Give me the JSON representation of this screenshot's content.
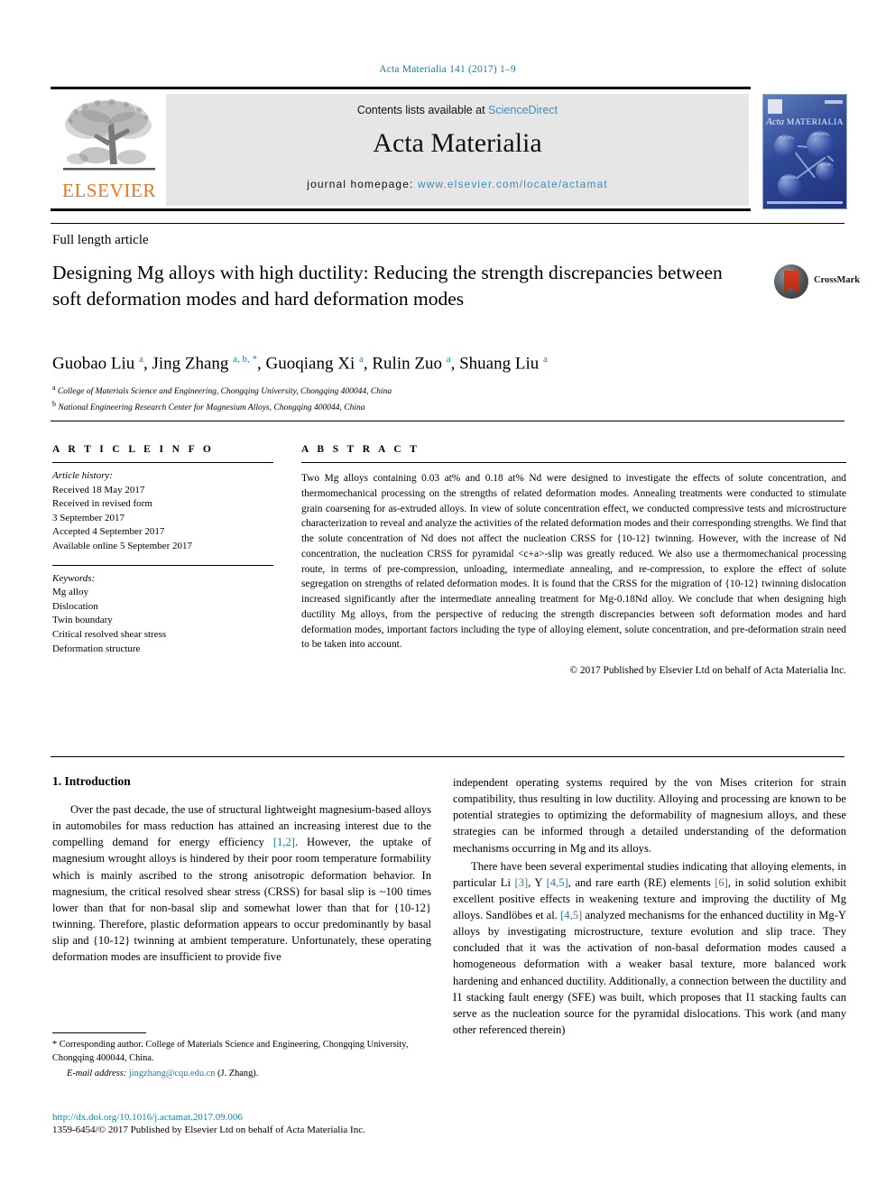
{
  "running_head": "Acta Materialia 141 (2017) 1–9",
  "masthead": {
    "publisher_name": "ELSEVIER",
    "contents_prefix": "Contents lists available at ",
    "contents_link": "ScienceDirect",
    "journal_name": "Acta Materialia",
    "homepage_prefix": "journal homepage: ",
    "homepage_url": "www.elsevier.com/locate/actamat",
    "cover": {
      "title_italic": "Acta",
      "title_caps": "MATERIALIA",
      "nodes": [
        "STRUCTURE",
        "PROPERTIES",
        "THEORY",
        "PROCESSING"
      ]
    }
  },
  "article": {
    "type": "Full length article",
    "title": "Designing Mg alloys with high ductility: Reducing the strength discrepancies between soft deformation modes and hard deformation modes",
    "crossmark_label": "CrossMark",
    "authors_html": "Guobao Liu <sup>a</sup>, Jing Zhang <sup>a, b, *</sup>, Guoqiang Xi <sup>a</sup>, Rulin Zuo <sup>a</sup>, Shuang Liu <sup>a</sup>",
    "affiliations": [
      {
        "marker": "a",
        "text": "College of Materials Science and Engineering, Chongqing University, Chongqing 400044, China"
      },
      {
        "marker": "b",
        "text": "National Engineering Research Center for Magnesium Alloys, Chongqing 400044, China"
      }
    ]
  },
  "info": {
    "heading": "A R T I C L E  I N F O",
    "history_label": "Article history:",
    "history": [
      "Received 18 May 2017",
      "Received in revised form",
      "3 September 2017",
      "Accepted 4 September 2017",
      "Available online 5 September 2017"
    ],
    "keywords_label": "Keywords:",
    "keywords": [
      "Mg alloy",
      "Dislocation",
      "Twin boundary",
      "Critical resolved shear stress",
      "Deformation structure"
    ]
  },
  "abstract": {
    "heading": "A B S T R A C T",
    "text": "Two Mg alloys containing 0.03 at% and 0.18 at% Nd were designed to investigate the effects of solute concentration, and thermomechanical processing on the strengths of related deformation modes. Annealing treatments were conducted to stimulate grain coarsening for as-extruded alloys. In view of solute concentration effect, we conducted compressive tests and microstructure characterization to reveal and analyze the activities of the related deformation modes and their corresponding strengths. We find that the solute concentration of Nd does not affect the nucleation CRSS for {10-12} twinning. However, with the increase of Nd concentration, the nucleation CRSS for pyramidal <c+a>-slip was greatly reduced. We also use a thermomechanical processing route, in terms of pre-compression, unloading, intermediate annealing, and re-compression, to explore the effect of solute segregation on strengths of related deformation modes. It is found that the CRSS for the migration of {10-12} twinning dislocation increased significantly after the intermediate annealing treatment for Mg-0.18Nd alloy. We conclude that when designing high ductility Mg alloys, from the perspective of reducing the strength discrepancies between soft deformation modes and hard deformation modes, important factors including the type of alloying element, solute concentration, and pre-deformation strain need to be taken into account.",
    "copyright": "© 2017 Published by Elsevier Ltd on behalf of Acta Materialia Inc."
  },
  "body": {
    "section_heading": "1.  Introduction",
    "left_paragraphs": [
      "Over the past decade, the use of structural lightweight magnesium-based alloys in automobiles for mass reduction has attained an increasing interest due to the compelling demand for energy efficiency [1,2]. However, the uptake of magnesium wrought alloys is hindered by their poor room temperature formability which is mainly ascribed to the strong anisotropic deformation behavior. In magnesium, the critical resolved shear stress (CRSS) for basal slip is ~100 times lower than that for non-basal slip and somewhat lower than that for {10-12} twinning. Therefore, plastic deformation appears to occur predominantly by basal slip and {10-12} twinning at ambient temperature. Unfortunately, these operating deformation modes are insufficient to provide five"
    ],
    "right_paragraphs": [
      "independent operating systems required by the von Mises criterion for strain compatibility, thus resulting in low ductility. Alloying and processing are known to be potential strategies to optimizing the deformability of magnesium alloys, and these strategies can be informed through a detailed understanding of the deformation mechanisms occurring in Mg and its alloys.",
      "There have been several experimental studies indicating that alloying elements, in particular Li [3], Y [4,5], and rare earth (RE) elements [6], in solid solution exhibit excellent positive effects in weakening texture and improving the ductility of Mg alloys. Sandlöbes et al. [4,5] analyzed mechanisms for the enhanced ductility in Mg-Y alloys by investigating microstructure, texture evolution and slip trace. They concluded that it was the activation of non-basal deformation modes caused a homogeneous deformation with a weaker basal texture, more balanced work hardening and enhanced ductility. Additionally, a connection between the ductility and I1 stacking fault energy (SFE) was built, which proposes that I1 stacking faults can serve as the nucleation source for the pyramidal <c+a> dislocations. This work (and many other referenced therein)"
    ]
  },
  "footnote": {
    "corresponding": "* Corresponding author. College of Materials Science and Engineering, Chongqing University, Chongqing 400044, China.",
    "email_label": "E-mail address:",
    "email": "jingzhang@cqu.edu.cn",
    "email_owner": "(J. Zhang)."
  },
  "bottom": {
    "doi": "http://dx.doi.org/10.1016/j.actamat.2017.09.006",
    "issn_line": "1359-6454/© 2017 Published by Elsevier Ltd on behalf of Acta Materialia Inc."
  },
  "colors": {
    "link": "#1a7fa8",
    "elsevier_orange": "#E87722",
    "panel_grey": "#e6e6e6"
  }
}
